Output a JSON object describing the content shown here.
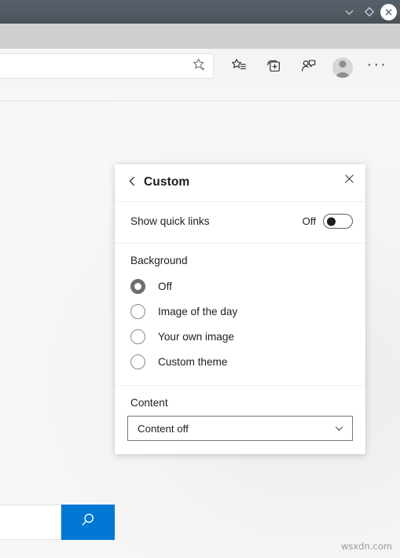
{
  "window": {
    "controls": [
      {
        "name": "minimize-to-tray",
        "icon": "chevron-down-icon"
      },
      {
        "name": "restore",
        "icon": "diamond-icon"
      },
      {
        "name": "close",
        "icon": "close-icon"
      }
    ]
  },
  "toolbar": {
    "address_bar": {
      "value": "",
      "placeholder": ""
    },
    "favorite_icon": "add-favorite-star-icon",
    "actions": [
      {
        "name": "favorites",
        "icon": "favorites-star-list-icon"
      },
      {
        "name": "collections",
        "icon": "collections-icon"
      },
      {
        "name": "browser-essentials",
        "icon": "person-chat-icon"
      },
      {
        "name": "profile",
        "icon": "avatar-icon"
      },
      {
        "name": "settings-and-more",
        "icon": "ellipsis-icon",
        "label": "···"
      }
    ]
  },
  "page": {
    "settings_gear": "gear-icon",
    "search": {
      "input_value": "",
      "button_icon": "search-magnifier-icon",
      "button_color": "#0078d4"
    },
    "watermark": "wsxdn.com"
  },
  "panel": {
    "back_icon": "chevron-left-icon",
    "title": "Custom",
    "close_icon": "close-icon",
    "quick_links": {
      "label": "Show quick links",
      "state": "Off",
      "checked": false
    },
    "background": {
      "title": "Background",
      "options": [
        {
          "label": "Off",
          "checked": true
        },
        {
          "label": "Image of the day",
          "checked": false
        },
        {
          "label": "Your own image",
          "checked": false
        },
        {
          "label": "Custom theme",
          "checked": false
        }
      ]
    },
    "content": {
      "title": "Content",
      "selected": "Content off",
      "chevron_icon": "chevron-down-icon"
    }
  }
}
